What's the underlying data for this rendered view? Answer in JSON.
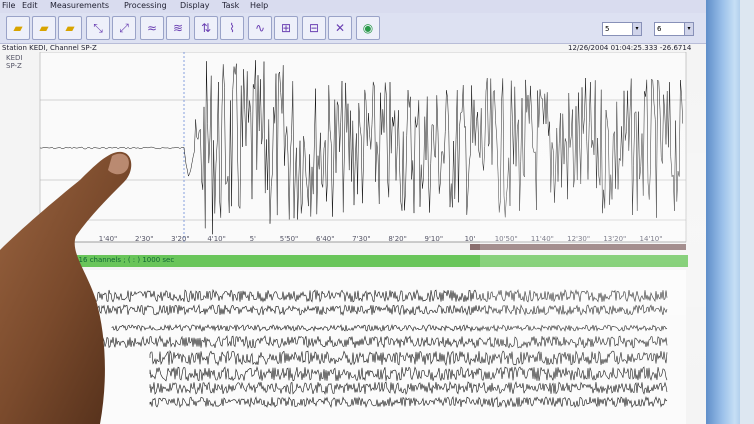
{
  "menu": [
    "File",
    "Edit",
    "Measurements",
    "Processing",
    "Display",
    "Task",
    "Help"
  ],
  "toolbar": {
    "select_left": "5",
    "select_right": "6"
  },
  "station": "Station KEDI, Channel SP-Z",
  "timestamp": "12/26/2004 01:04:25.333    -26.6714",
  "trace_label": "KEDI\nSP-Z",
  "x_ticks": [
    "1'40\"",
    "2'30\"",
    "3'20\"",
    "4'10\"",
    "5'",
    "5'50\"",
    "6'40\"",
    "7'30\"",
    "8'20\"",
    "9'10\"",
    "10'",
    "10'50\"",
    "11'40\"",
    "12'30\"",
    "13'20\"",
    "14'10\""
  ],
  "green_bar_text": "(km) 16 channels ; ( : ) 1000 sec",
  "colors": {
    "screen": "#f4f4f4",
    "trace": "#111111",
    "green": "#69c55a",
    "bezel": "#7ea6d6",
    "skin": "#7a4a2c"
  }
}
